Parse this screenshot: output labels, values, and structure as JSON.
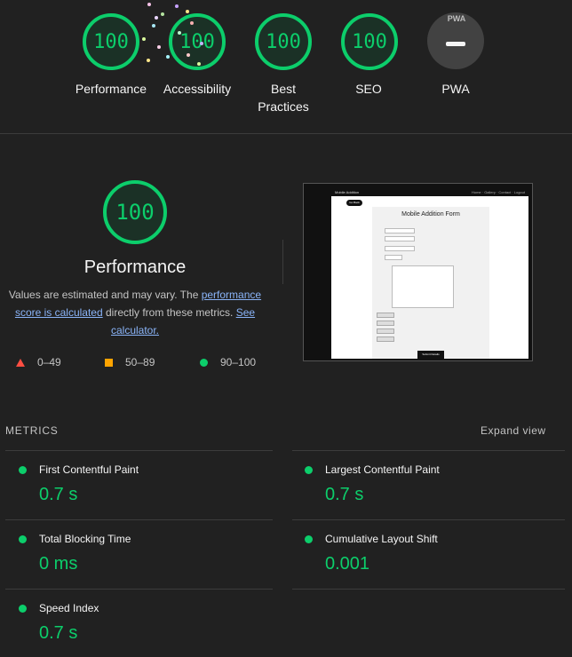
{
  "categories": [
    {
      "label": "Performance",
      "score": "100"
    },
    {
      "label": "Accessibility",
      "score": "100"
    },
    {
      "label": "Best Practices",
      "score": "100"
    },
    {
      "label": "SEO",
      "score": "100"
    },
    {
      "label": "PWA",
      "score": ""
    }
  ],
  "pwa_badge_text": "PWA",
  "performance": {
    "score": "100",
    "title": "Performance",
    "desc_prefix": "Values are estimated and may vary. The ",
    "link_score": "performance score is calculated",
    "desc_middle": " directly from these metrics. ",
    "link_calc": "See calculator.",
    "legend": [
      "0–49",
      "50–89",
      "90–100"
    ]
  },
  "screenshot": {
    "brand": "Mobile Addition",
    "nav_links": "Home · Gallery · Contact · Logout",
    "button": "Go Back",
    "form_title": "Mobile Addition Form",
    "submit": "Submit Details",
    "row_text": "No file chosen",
    "chip_text": "Choose File"
  },
  "metrics": {
    "heading": "METRICS",
    "expand_label": "Expand view",
    "items": [
      {
        "name": "First Contentful Paint",
        "value": "0.7 s"
      },
      {
        "name": "Largest Contentful Paint",
        "value": "0.7 s"
      },
      {
        "name": "Total Blocking Time",
        "value": "0 ms"
      },
      {
        "name": "Cumulative Layout Shift",
        "value": "0.001"
      },
      {
        "name": "Speed Index",
        "value": "0.7 s"
      }
    ]
  },
  "colors": {
    "pass": "#0cce6b",
    "average": "#ffa400",
    "fail": "#ff4e42",
    "link": "#8ab4f8"
  }
}
